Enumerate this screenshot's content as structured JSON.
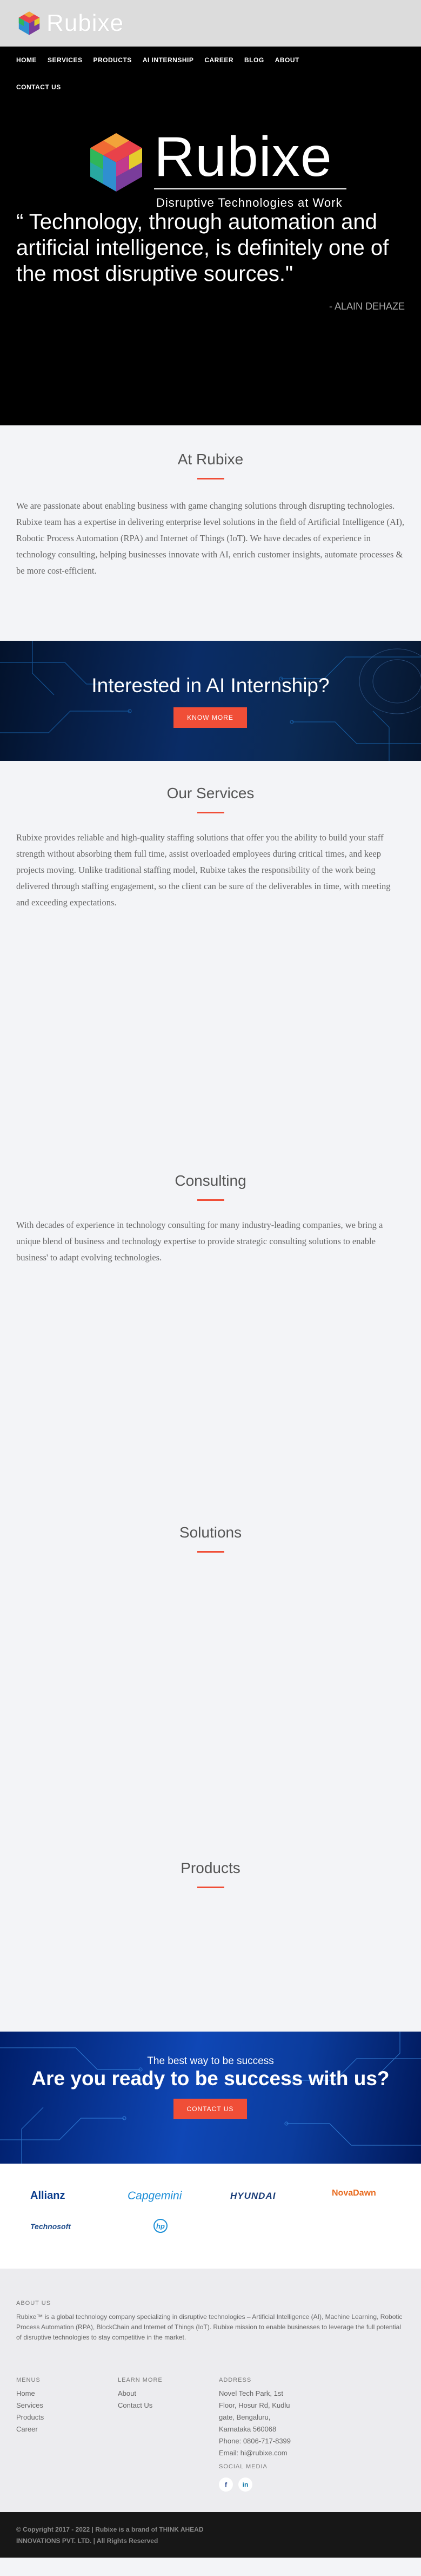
{
  "brand": {
    "name": "Rubixe",
    "tagline": "Disruptive Technologies at Work"
  },
  "nav": {
    "items": [
      "HOME",
      "SERVICES",
      "PRODUCTS",
      "AI INTERNSHIP",
      "CAREER",
      "BLOG",
      "ABOUT"
    ],
    "second_row": "CONTACT US"
  },
  "hero": {
    "quote": "“ Technology, through automation and artificial intelligence, is definitely one of the most disruptive sources.\"",
    "author": "- ALAIN DEHAZE"
  },
  "at_rubixe": {
    "title": "At Rubixe",
    "text": "We are passionate about enabling business with game changing solutions through disrupting technologies. Rubixe team has a expertise in delivering enterprise level solutions in the field of Artificial Intelligence (AI), Robotic Process Automation (RPA) and Internet of Things (IoT). We have decades of experience in technology consulting, helping businesses innovate with AI, enrich customer insights, automate processes & be more cost-efficient."
  },
  "internship": {
    "title": "Interested in AI Internship?",
    "button": "KNOW MORE"
  },
  "services": {
    "title": "Our Services",
    "text": "Rubixe provides reliable and high-quality staffing solutions that offer you the ability to build your staff strength without absorbing them full time, assist overloaded employees during critical times, and keep projects moving. Unlike traditional staffing model, Rubixe takes the responsibility of the work being delivered through staffing engagement, so the client can be sure of the deliverables in time, with meeting and exceeding expectations."
  },
  "consulting": {
    "title": "Consulting",
    "text": "With decades of experience in technology consulting for many industry-leading companies, we bring a unique blend of business and technology expertise to provide strategic consulting solutions to enable business' to adapt evolving technologies."
  },
  "solutions": {
    "title": "Solutions"
  },
  "products": {
    "title": "Products"
  },
  "success": {
    "subtitle": "The best way to be success",
    "title": "Are you ready to be success with us?",
    "button": "CONTACT US"
  },
  "clients": [
    "Allianz",
    "Capgemini",
    "HYUNDAI",
    "NovaDawn",
    "Technosoft",
    "hp"
  ],
  "footer": {
    "about_head": "ABOUT US",
    "about_text": "Rubixe™ is a global technology company specializing in disruptive technologies – Artificial Intelligence (AI), Machine Learning, Robotic Process Automation (RPA), BlockChain and Internet of Things (IoT). Rubixe mission to enable businesses to leverage the full potential of disruptive technologies to stay competitive in the market.",
    "menus_head": "MENUS",
    "menus": [
      "Home",
      "Services",
      "Products",
      "Career"
    ],
    "learn_head": "LEARN MORE",
    "learn": [
      "About",
      "Contact Us"
    ],
    "address_head": "ADDRESS",
    "address_lines": [
      "Novel Tech Park, 1st",
      "Floor, Hosur Rd, Kudlu",
      "gate, Bengaluru,",
      "Karnataka 560068"
    ],
    "phone": "Phone: 0806-717-8399",
    "email": "Email: hi@rubixe.com",
    "social_head": "SOCIAL MEDIA",
    "social": [
      "f",
      "in"
    ]
  },
  "copyright": {
    "line1": "© Copyright 2017 - 2022 | Rubixe is a brand of THINK AHEAD",
    "line2": "INNOVATIONS PVT. LTD. | All Rights Reserved"
  },
  "colors": {
    "accent": "#f04e37",
    "nav_bg": "#000000",
    "hero_bg": "#000000",
    "page_bg": "#f3f4f7"
  }
}
